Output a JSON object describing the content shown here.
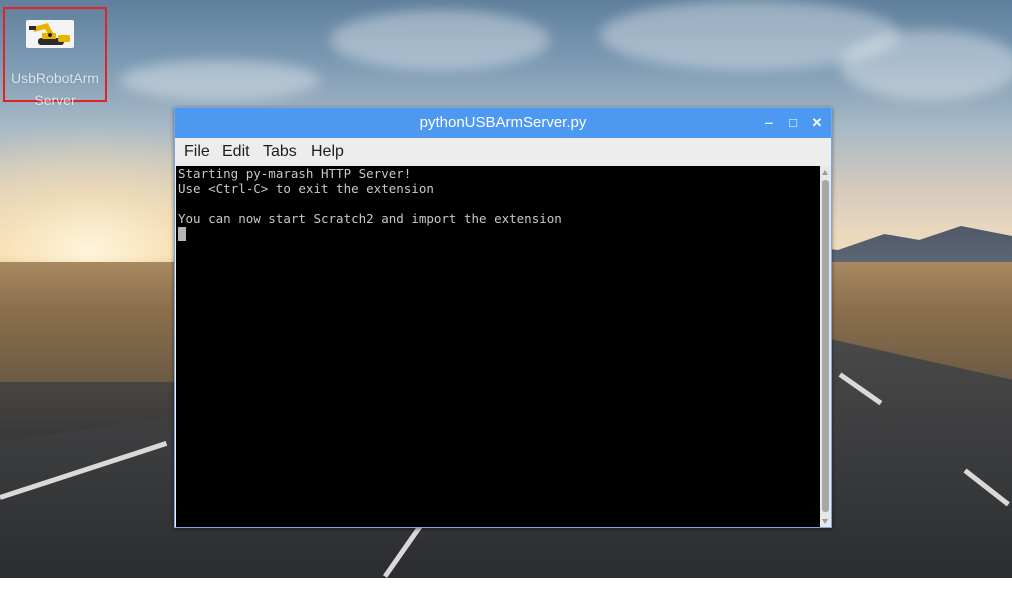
{
  "desktop": {
    "icon": {
      "name": "robot-arm-icon",
      "label": "UsbRobotArm Server"
    }
  },
  "window": {
    "title": "pythonUSBArmServer.py",
    "controls": {
      "minimize": "‒",
      "maximize": "□",
      "close": "✕"
    },
    "menu": [
      "File",
      "Edit",
      "Tabs",
      "Help"
    ]
  },
  "terminal": {
    "lines": [
      "Starting py-marash HTTP Server!",
      "Use <Ctrl-C> to exit the extension",
      "",
      "You can now start Scratch2 and import the extension"
    ]
  },
  "colors": {
    "titlebar": "#4d98f0",
    "terminal_bg": "#000000",
    "terminal_fg": "#c8c8c8",
    "highlight_border": "#e02424"
  }
}
